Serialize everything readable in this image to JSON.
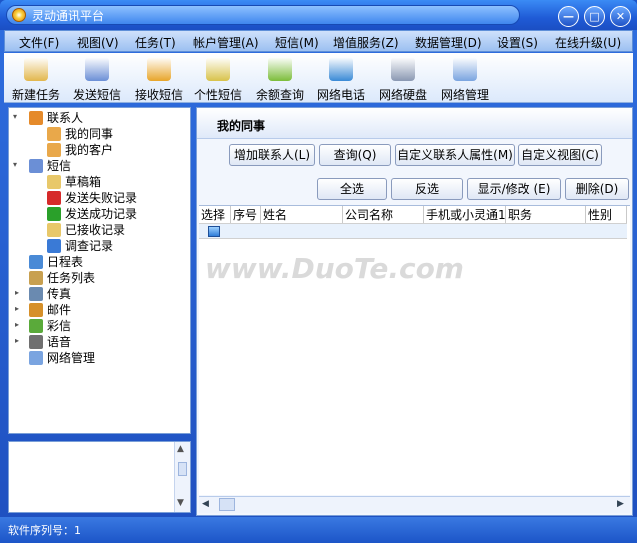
{
  "window": {
    "title": "灵动通讯平台"
  },
  "titlebar_buttons": {
    "minimize": "—",
    "maximize": "□",
    "close": "✕"
  },
  "menu": [
    "文件(F)",
    "视图(V)",
    "任务(T)",
    "帐户管理(A)",
    "短信(M)",
    "增值服务(Z)",
    "数据管理(D)",
    "设置(S)",
    "在线升级(U)"
  ],
  "toolbar": [
    {
      "label": "新建任务",
      "icon": "new-task-icon",
      "color": "#e2b64c"
    },
    {
      "label": "发送短信",
      "icon": "send-sms-icon",
      "color": "#6b8fd6"
    },
    {
      "label": "接收短信",
      "icon": "receive-sms-icon",
      "color": "#e8a52a"
    },
    {
      "label": "个性短信",
      "icon": "custom-sms-icon",
      "color": "#d8c24a"
    },
    {
      "label": "余额查询",
      "icon": "balance-icon",
      "color": "#7cbd3a"
    },
    {
      "label": "网络电话",
      "icon": "phone-icon",
      "color": "#3a8ad6"
    },
    {
      "label": "网络硬盘",
      "icon": "disk-icon",
      "color": "#8a98b2"
    },
    {
      "label": "网络管理",
      "icon": "network-icon",
      "color": "#7aa4e0"
    }
  ],
  "tree": [
    {
      "label": "联系人",
      "level": 0,
      "icon": "contacts-icon",
      "color": "#e58a2a"
    },
    {
      "label": "我的同事",
      "level": 1,
      "icon": "person-icon",
      "color": "#e9a84a"
    },
    {
      "label": "我的客户",
      "level": 1,
      "icon": "person-icon",
      "color": "#e9a84a"
    },
    {
      "label": "短信",
      "level": 0,
      "icon": "sms-folder-icon",
      "color": "#6b8fd6"
    },
    {
      "label": "草稿箱",
      "level": 1,
      "icon": "draft-icon",
      "color": "#e8c86a"
    },
    {
      "label": "发送失败记录",
      "level": 1,
      "icon": "fail-icon",
      "color": "#d62a2a"
    },
    {
      "label": "发送成功记录",
      "level": 1,
      "icon": "success-icon",
      "color": "#2aa02a"
    },
    {
      "label": "已接收记录",
      "level": 1,
      "icon": "received-icon",
      "color": "#e8c86a"
    },
    {
      "label": "调查记录",
      "level": 1,
      "icon": "survey-icon",
      "color": "#3a7ad6"
    },
    {
      "label": "日程表",
      "level": 0,
      "icon": "calendar-icon",
      "color": "#4a8ad6"
    },
    {
      "label": "任务列表",
      "level": 0,
      "icon": "tasklist-icon",
      "color": "#c8a050"
    },
    {
      "label": "传真",
      "level": 0,
      "icon": "fax-icon",
      "color": "#6a8ab0"
    },
    {
      "label": "邮件",
      "level": 0,
      "icon": "mail-icon",
      "color": "#d6902a"
    },
    {
      "label": "彩信",
      "level": 0,
      "icon": "mms-icon",
      "color": "#5aaa3a"
    },
    {
      "label": "语音",
      "level": 0,
      "icon": "voice-icon",
      "color": "#707070"
    },
    {
      "label": "网络管理",
      "level": 0,
      "icon": "network-icon",
      "color": "#7aa4e0"
    }
  ],
  "content": {
    "title": "我的同事",
    "action_buttons": [
      "增加联系人(L)",
      "查询(Q)",
      "自定义联系人属性(M)",
      "自定义视图(C)"
    ],
    "grid_buttons": [
      "全选",
      "反选",
      "显示/修改 (E)",
      "删除(D)"
    ],
    "columns": [
      "选择",
      "序号",
      "姓名",
      "公司名称",
      "手机或小灵通1",
      "职务",
      "性别"
    ]
  },
  "watermark": "www.DuoTe.com",
  "status": {
    "text": "软件序列号：1"
  }
}
